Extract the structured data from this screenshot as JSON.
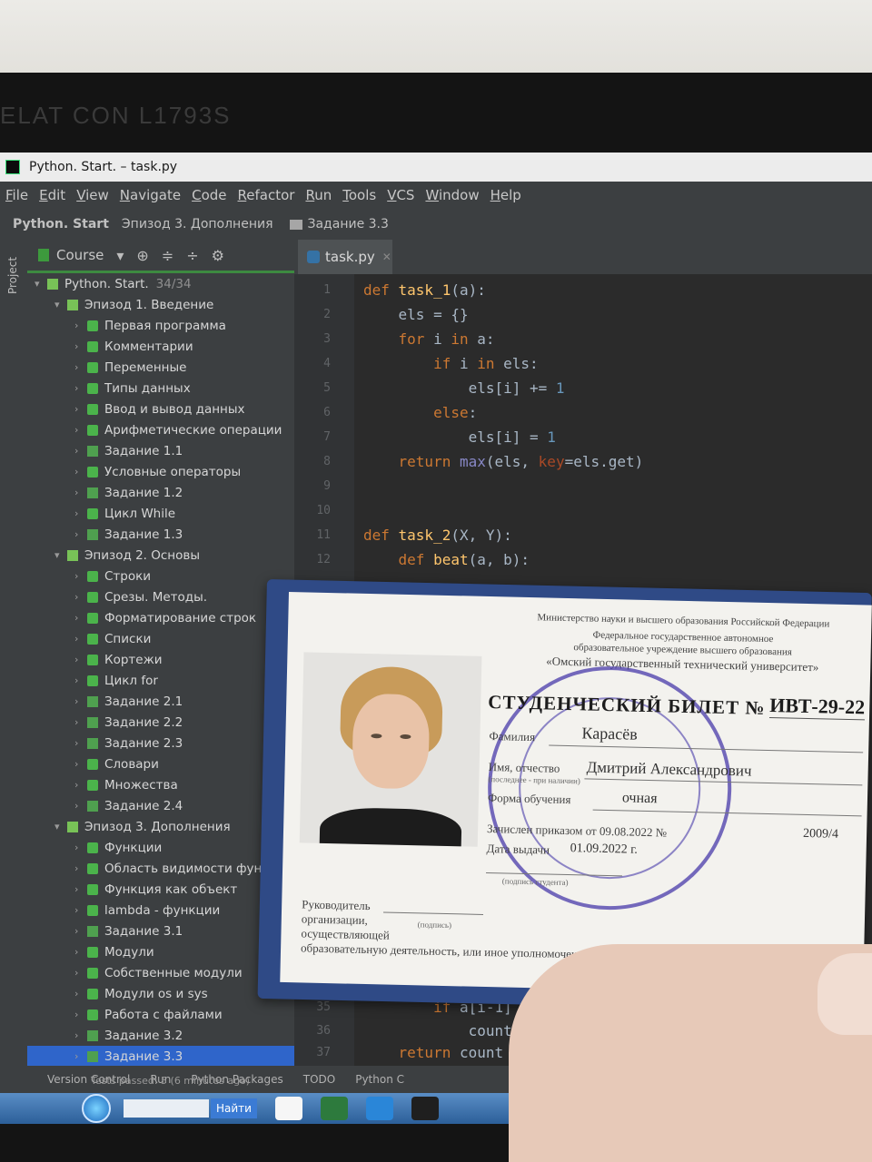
{
  "monitor": {
    "brand": "ELAT CON L1793S"
  },
  "ide": {
    "window_title": "Python. Start. – task.py",
    "menu": [
      "File",
      "Edit",
      "View",
      "Navigate",
      "Code",
      "Refactor",
      "Run",
      "Tools",
      "VCS",
      "Window",
      "Help"
    ],
    "breadcrumbs": [
      "Python. Start",
      "Эпизод 3. Дополнения",
      "Задание 3.3"
    ],
    "tool_window_label": "Project",
    "panel_title": "Course",
    "tree": [
      {
        "label": "Python. Start.",
        "count": "34/34"
      },
      {
        "label": "Эпизод 1. Введение"
      },
      {
        "label": "Первая программа"
      },
      {
        "label": "Комментарии"
      },
      {
        "label": "Переменные"
      },
      {
        "label": "Типы данных"
      },
      {
        "label": "Ввод и вывод данных"
      },
      {
        "label": "Арифметические операции"
      },
      {
        "label": "Задание 1.1"
      },
      {
        "label": "Условные операторы"
      },
      {
        "label": "Задание 1.2"
      },
      {
        "label": "Цикл While"
      },
      {
        "label": "Задание 1.3"
      },
      {
        "label": "Эпизод 2. Основы"
      },
      {
        "label": "Строки"
      },
      {
        "label": "Срезы. Методы."
      },
      {
        "label": "Форматирование строк"
      },
      {
        "label": "Списки"
      },
      {
        "label": "Кортежи"
      },
      {
        "label": "Цикл for"
      },
      {
        "label": "Задание 2.1"
      },
      {
        "label": "Задание 2.2"
      },
      {
        "label": "Задание 2.3"
      },
      {
        "label": "Словари"
      },
      {
        "label": "Множества"
      },
      {
        "label": "Задание 2.4"
      },
      {
        "label": "Эпизод 3. Дополнения"
      },
      {
        "label": "Функции"
      },
      {
        "label": "Область видимости функ"
      },
      {
        "label": "Функция как объект"
      },
      {
        "label": "lambda - функции"
      },
      {
        "label": "Задание 3.1"
      },
      {
        "label": "Модули"
      },
      {
        "label": "Собственные модули"
      },
      {
        "label": "Модули os и sys"
      },
      {
        "label": "Работа с файлами"
      },
      {
        "label": "Задание 3.2"
      },
      {
        "label": "Задание 3.3"
      }
    ],
    "tab_label": "task.py",
    "line_numbers": [
      "1",
      "2",
      "3",
      "4",
      "5",
      "6",
      "7",
      "8",
      "9",
      "10",
      "11",
      "12",
      "35",
      "36",
      "37"
    ],
    "code": {
      "l1a": "def ",
      "l1b": "task_1",
      "l1c": "(a):",
      "l2": "    els = {}",
      "l3a": "    for ",
      "l3b": "i ",
      "l3c": "in ",
      "l3d": "a:",
      "l4a": "        if ",
      "l4b": "i ",
      "l4c": "in ",
      "l4d": "els:",
      "l5a": "            els[i] += ",
      "l5b": "1",
      "l6a": "        else",
      ":": ":",
      "l6b": ":",
      "l7a": "            els[i] = ",
      "l7b": "1",
      "l8a": "    return ",
      "l8b": "max",
      "l8c": "(els, ",
      "l8d": "key",
      "l8e": "=els.get)",
      "l11a": "def ",
      "l11b": "task_2",
      "l11c": "(X, Y):",
      "l12a": "    def ",
      "l12b": "beat",
      "l12c": "(a, b):",
      "l35a": "        if ",
      "l35b": "a[i-1] < a[i] an",
      "l36": "            count += 1",
      "l37a": "    return ",
      "l37b": "count"
    },
    "bottom_tabs": [
      "Version Control",
      "Run",
      "Python Packages",
      "TODO",
      "Python C"
    ],
    "status_message": "Tests passed: 5 (6 minutes ago)",
    "taskbar_search_button": "Найти"
  },
  "student_card": {
    "ministry": "Министерство науки и высшего образования Российской Федерации",
    "institution_line1": "Федеральное государственное автономное",
    "institution_line2": "образовательное учреждение высшего образования",
    "institution_line3": "«Омский государственный технический университет»",
    "title": "СТУДЕНЧЕСКИЙ БИЛЕТ №",
    "number": "ИВТ-29-22",
    "surname_label": "Фамилия",
    "surname": "Карасёв",
    "name_label": "Имя, отчество",
    "name_hint": "(последнее - при наличии)",
    "name": "Дмитрий Александрович",
    "form_label": "Форма обучения",
    "form": "очная",
    "enrolled_label": "Зачислен приказом от 09.08.2022 №",
    "enrolled_number": "2009/4",
    "issued_label": "Дата выдачи",
    "issued_date": "01.09.2022 г.",
    "signature_hint": "(подпись студента)",
    "head_label_1": "Руководитель",
    "head_label_2": "организации,",
    "head_label_3": "осуществляющей",
    "head_signature_hint": "(подпись)",
    "head_label_4": "образовательную деятельность, или иное уполномоченное им лицо"
  }
}
